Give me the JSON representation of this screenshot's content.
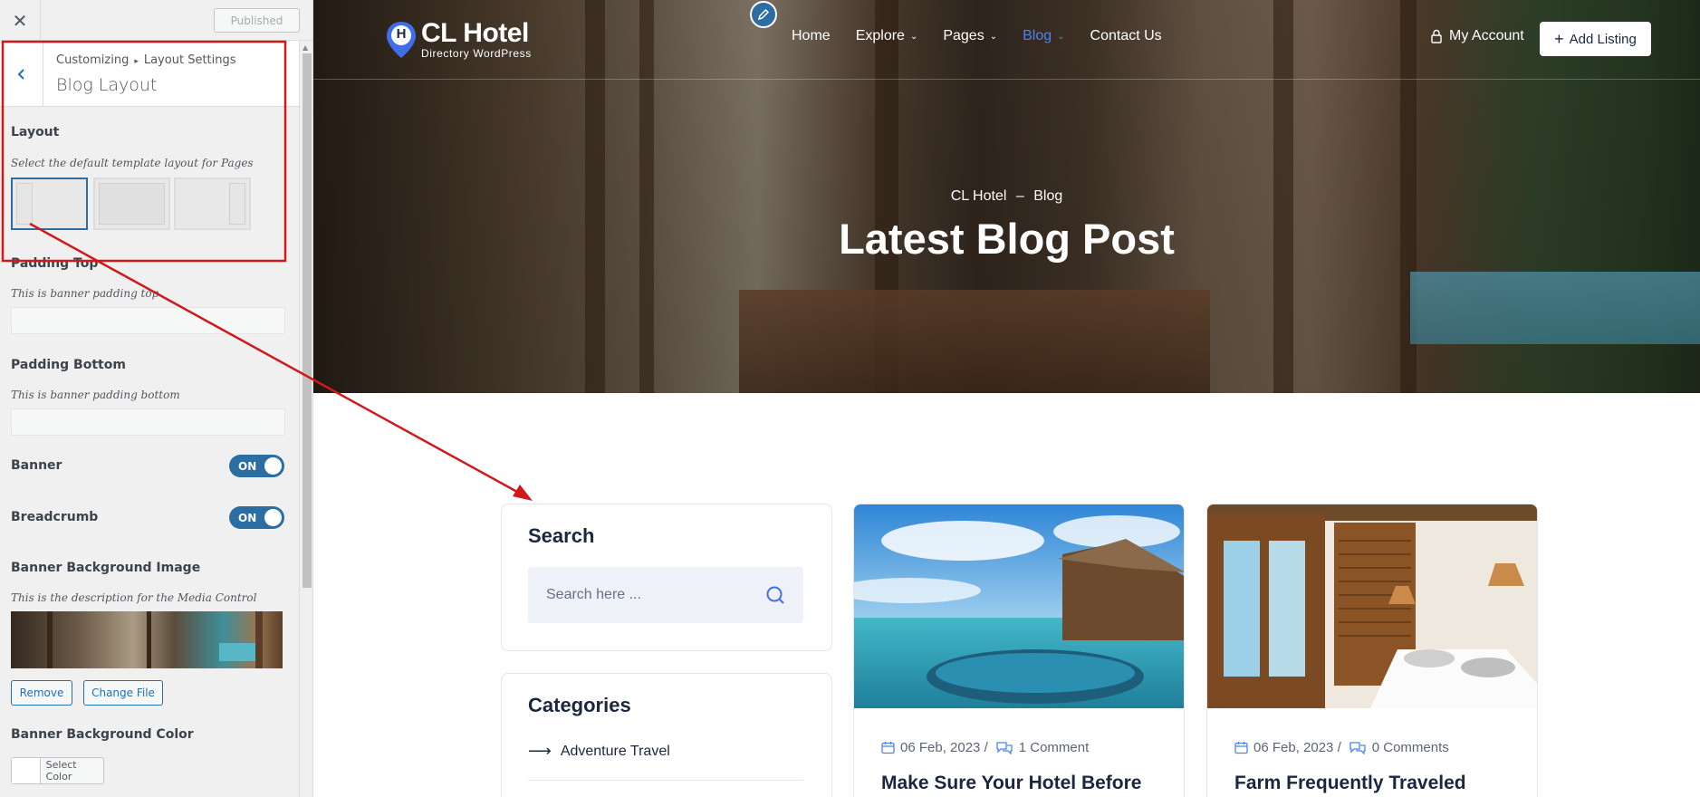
{
  "customizer": {
    "close_label": "✕",
    "published_label": "Published",
    "breadcrumb": {
      "root": "Customizing",
      "sep": "▸",
      "parent": "Layout Settings"
    },
    "section_title": "Blog Layout",
    "layout": {
      "title": "Layout",
      "description": "Select the default template layout for Pages"
    },
    "padding_top": {
      "title": "Padding Top",
      "description": "This is banner padding top"
    },
    "padding_bottom": {
      "title": "Padding Bottom",
      "description": "This is banner padding bottom"
    },
    "banner": {
      "title": "Banner",
      "toggle": "ON"
    },
    "breadcrumb_ctl": {
      "title": "Breadcrumb",
      "toggle": "ON"
    },
    "banner_image": {
      "title": "Banner Background Image",
      "description": "This is the description for the Media Control",
      "remove_label": "Remove",
      "change_label": "Change File"
    },
    "banner_color": {
      "title": "Banner Background Color",
      "select_label": "Select Color"
    }
  },
  "site": {
    "logo": {
      "title": "CL Hotel",
      "subtitle": "Directory WordPress",
      "mark": "H"
    },
    "nav": [
      {
        "label": "Home",
        "dropdown": false,
        "active": false
      },
      {
        "label": "Explore",
        "dropdown": true,
        "active": false
      },
      {
        "label": "Pages",
        "dropdown": true,
        "active": false
      },
      {
        "label": "Blog",
        "dropdown": true,
        "active": true
      },
      {
        "label": "Contact Us",
        "dropdown": false,
        "active": false
      }
    ],
    "my_account": "My Account",
    "add_listing": "Add Listing",
    "hero": {
      "crumb_home": "CL Hotel",
      "crumb_sep": "–",
      "crumb_current": "Blog",
      "title": "Latest Blog Post"
    },
    "search_widget": {
      "title": "Search",
      "placeholder": "Search here ..."
    },
    "categories_widget": {
      "title": "Categories",
      "items": [
        "Adventure Travel"
      ]
    },
    "posts": [
      {
        "date": "06 Feb, 2023 /",
        "comments": "1 Comment",
        "title": "Make Sure Your Hotel Before"
      },
      {
        "date": "06 Feb, 2023 /",
        "comments": "0 Comments",
        "title": "Farm Frequently Traveled"
      }
    ]
  },
  "colors": {
    "accent": "#2c6da2",
    "nav_active": "#4c84f0",
    "annotation": "#d0191b",
    "heading": "#1b2740"
  },
  "icons": [
    "close-icon",
    "back-chevron-icon",
    "pencil-icon",
    "lock-icon",
    "chevron-down-icon",
    "plus-icon",
    "search-icon",
    "arrow-right-icon",
    "calendar-icon",
    "comments-icon"
  ]
}
